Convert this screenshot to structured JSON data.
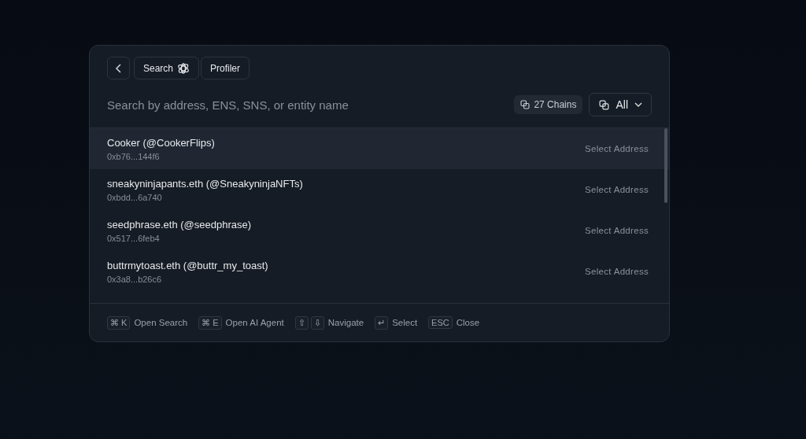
{
  "nav": {
    "buttons": [
      {
        "kind": "back"
      },
      {
        "kind": "search",
        "label": "Search"
      },
      {
        "kind": "text",
        "label": "Profiler"
      }
    ]
  },
  "search": {
    "placeholder": "Search by address, ENS, SNS, or entity name",
    "chains": "27 Chains",
    "filter": "All"
  },
  "results": [
    {
      "name": "Cooker (@CookerFlips)",
      "address": "0xb76...144f6",
      "action": "Select Address",
      "selected": true
    },
    {
      "name": "sneakyninjapants.eth (@SneakyninjaNFTs)",
      "address": "0xbdd...6a740",
      "action": "Select Address",
      "selected": false
    },
    {
      "name": "seedphrase.eth (@seedphrase)",
      "address": "0x517...6feb4",
      "action": "Select Address",
      "selected": false
    },
    {
      "name": "buttrmytoast.eth (@buttr_my_toast)",
      "address": "0x3a8...b26c6",
      "action": "Select Address",
      "selected": false
    }
  ],
  "shortcuts": [
    {
      "keys": [
        "⌘ K"
      ],
      "label": "Open Search"
    },
    {
      "keys": [
        "⌘ E"
      ],
      "label": "Open AI Agent"
    },
    {
      "keys": [
        "⇧",
        "⇩"
      ],
      "label": "Navigate"
    },
    {
      "keys": [
        "↵"
      ],
      "label": "Select"
    },
    {
      "keys": [
        "ESC"
      ],
      "label": "Close"
    }
  ]
}
